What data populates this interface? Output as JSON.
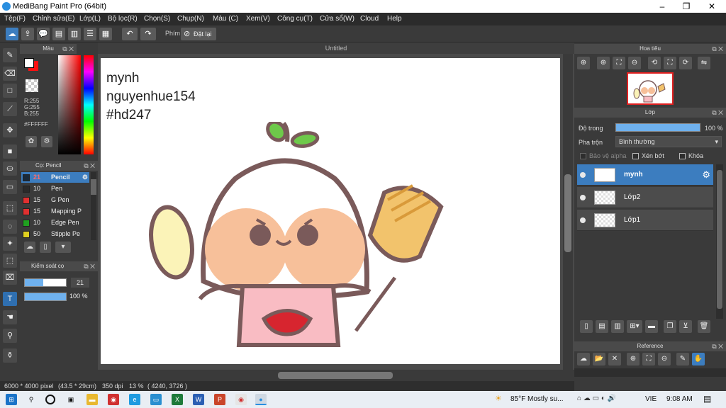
{
  "window": {
    "title": "MediBang Paint Pro (64bit)",
    "minimize": "–",
    "maximize": "❐",
    "close": "✕"
  },
  "menu": [
    "Tệp(F)",
    "Chỉnh sửa(E)",
    "Lớp(L)",
    "Bộ lọc(R)",
    "Chọn(S)",
    "Chụp(N)",
    "Màu (C)",
    "Xem(V)",
    "Công cụ(T)",
    "Cửa sổ(W)",
    "Cloud",
    "Help"
  ],
  "toolbar": {
    "shortcut_label": "Phím",
    "reset_label": "Đặt lại"
  },
  "color_panel": {
    "title": "Màu",
    "r": "R:255",
    "g": "G:255",
    "b": "B:255",
    "hex": "#FFFFFF",
    "primary_color": "#ffffff",
    "secondary_color": "#e0101a"
  },
  "brush_panel": {
    "title": "Cọ: Pencil",
    "brushes": [
      {
        "size": "21",
        "name": "Pencil",
        "color": "#1a2a3a"
      },
      {
        "size": "10",
        "name": "Pen",
        "color": "#2a2a2a"
      },
      {
        "size": "15",
        "name": "G Pen",
        "color": "#e03030"
      },
      {
        "size": "15",
        "name": "Mapping P",
        "color": "#e03030"
      },
      {
        "size": "10",
        "name": "Edge Pen",
        "color": "#20a020"
      },
      {
        "size": "50",
        "name": "Stipple Pe",
        "color": "#e0d020"
      }
    ]
  },
  "brush_control": {
    "title": "Kiểm soát cọ",
    "size_value": "21",
    "opacity_value": "100 %",
    "size_fraction": 0.45,
    "opacity_fraction": 1.0
  },
  "canvas": {
    "tab_title": "Untitled",
    "line1": "mynh",
    "line2": "nguyenhue154",
    "line3": "#hd247"
  },
  "status": {
    "size": "6000 * 4000 pixel",
    "physical": "(43.5 * 29cm)",
    "dpi": "350 dpi",
    "zoom": "13 %",
    "coords": "( 4240, 3726 )"
  },
  "navigator": {
    "title": "Hoa tiêu"
  },
  "layer_panel": {
    "title": "Lớp",
    "opacity_label": "Độ trong",
    "opacity_value": "100 %",
    "blend_label": "Pha trộn",
    "blend_value": "Bình thường",
    "protect_alpha": "Bảo vệ alpha",
    "clipping": "Xén bớt",
    "lock": "Khóa",
    "layers": [
      {
        "name": "mynh"
      },
      {
        "name": "Lớp2"
      },
      {
        "name": "Lớp1"
      }
    ]
  },
  "reference_panel": {
    "title": "Reference"
  },
  "taskbar": {
    "weather": "85°F  Mostly su...",
    "lang": "VIE",
    "time": "9:08 AM"
  },
  "colors": {
    "accent": "#3c7dbf",
    "panel_bg": "#3a3a3a",
    "canvas_bg": "#4a4a4a"
  }
}
